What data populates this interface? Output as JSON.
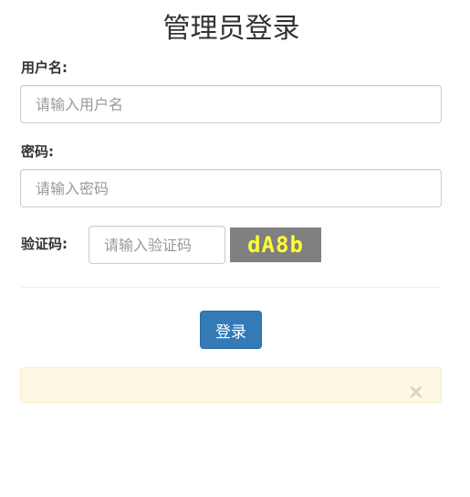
{
  "page": {
    "title": "管理员登录"
  },
  "form": {
    "username": {
      "label": "用户名:",
      "placeholder": "请输入用户名",
      "value": ""
    },
    "password": {
      "label": "密码:",
      "placeholder": "请输入密码",
      "value": ""
    },
    "captcha": {
      "label": "验证码:",
      "placeholder": "请输入验证码",
      "value": "",
      "image_text": "dA8b"
    },
    "submit_label": "登录"
  },
  "alert": {
    "close_symbol": "×",
    "message": ""
  },
  "colors": {
    "primary_button": "#337ab7",
    "alert_background": "#fcf8e3",
    "captcha_background": "#808080",
    "captcha_text": "#ffff33"
  }
}
